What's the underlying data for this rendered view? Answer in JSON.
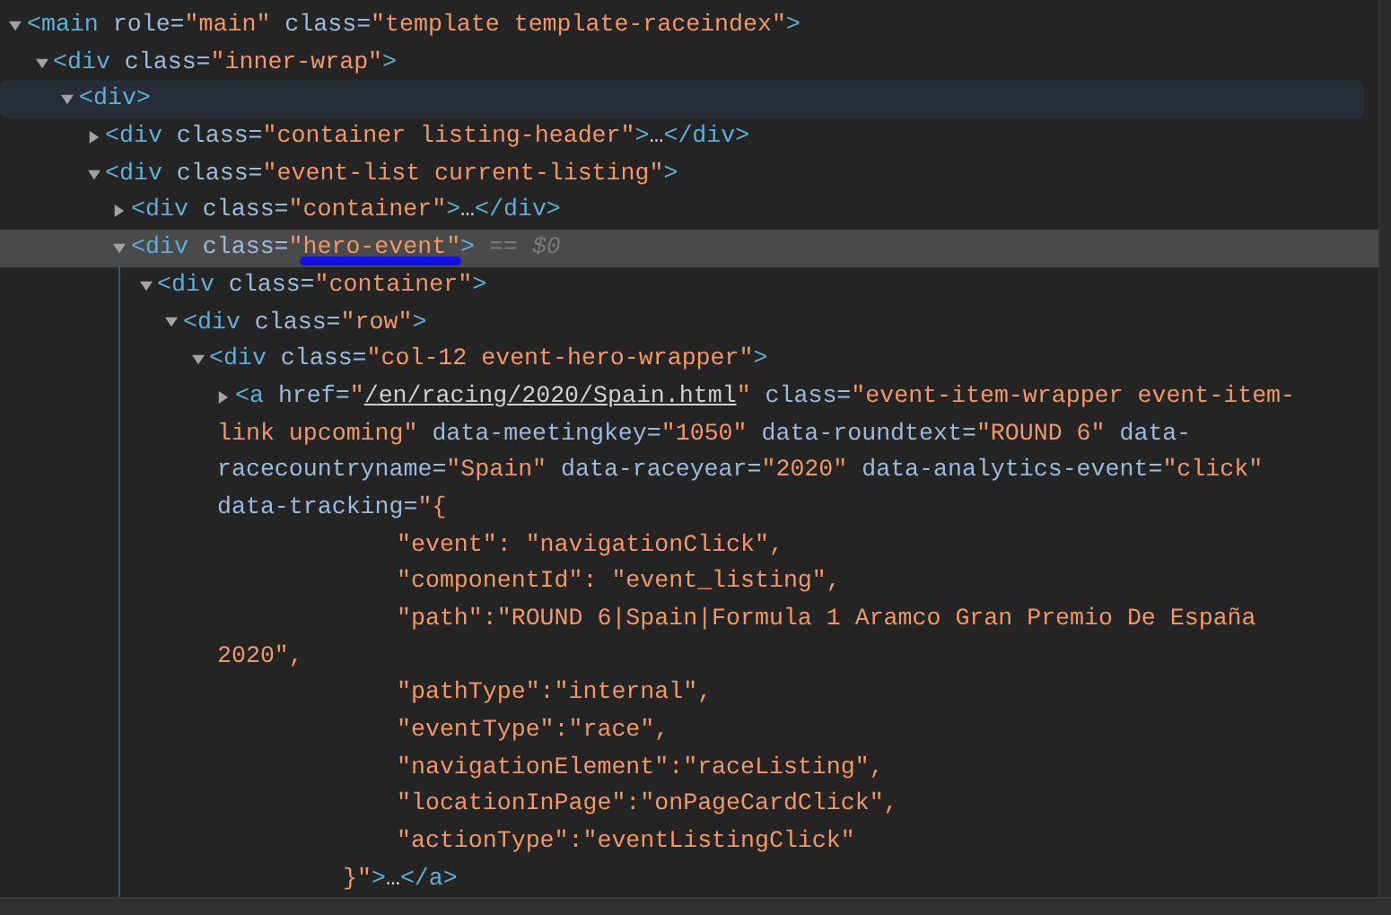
{
  "tree": [
    {
      "expanded": true,
      "selected": false,
      "hovered": false,
      "lines": [
        {
          "kind": "start",
          "tokens": [
            {
              "t": "<main",
              "kind": "tag"
            },
            {
              "t": " role=",
              "kind": "attr"
            },
            {
              "t": "\"main\"",
              "kind": "value"
            },
            {
              "t": " class=",
              "kind": "attr"
            },
            {
              "t": "\"template template-raceindex\"",
              "kind": "value"
            },
            {
              "t": ">",
              "kind": "tag"
            }
          ]
        }
      ],
      "children": [
        {
          "expanded": true,
          "selected": false,
          "hovered": false,
          "lines": [
            {
              "kind": "start",
              "tokens": [
                {
                  "t": "<div",
                  "kind": "tag"
                },
                {
                  "t": " class=",
                  "kind": "attr"
                },
                {
                  "t": "\"inner-wrap\"",
                  "kind": "value"
                },
                {
                  "t": ">",
                  "kind": "tag"
                }
              ]
            }
          ],
          "children": [
            {
              "expanded": true,
              "selected": false,
              "hovered": true,
              "lines": [
                {
                  "kind": "start",
                  "tokens": [
                    {
                      "t": "<div>",
                      "kind": "tag"
                    }
                  ]
                }
              ],
              "children": [
                {
                  "expanded": false,
                  "selected": false,
                  "hovered": false,
                  "lines": [
                    {
                      "kind": "start",
                      "tokens": [
                        {
                          "t": "<div",
                          "kind": "tag"
                        },
                        {
                          "t": " class=",
                          "kind": "attr"
                        },
                        {
                          "t": "\"container listing-header\"",
                          "kind": "value"
                        },
                        {
                          "t": ">",
                          "kind": "tag"
                        },
                        {
                          "t": "…",
                          "kind": "ellipsis"
                        },
                        {
                          "t": "</div>",
                          "kind": "tag"
                        }
                      ]
                    }
                  ]
                },
                {
                  "expanded": true,
                  "selected": false,
                  "hovered": false,
                  "lines": [
                    {
                      "kind": "start",
                      "tokens": [
                        {
                          "t": "<div",
                          "kind": "tag"
                        },
                        {
                          "t": " class=",
                          "kind": "attr"
                        },
                        {
                          "t": "\"event-list current-listing\"",
                          "kind": "value"
                        },
                        {
                          "t": ">",
                          "kind": "tag"
                        }
                      ]
                    }
                  ],
                  "children": [
                    {
                      "expanded": false,
                      "selected": false,
                      "hovered": false,
                      "lines": [
                        {
                          "kind": "start",
                          "tokens": [
                            {
                              "t": "<div",
                              "kind": "tag"
                            },
                            {
                              "t": " class=",
                              "kind": "attr"
                            },
                            {
                              "t": "\"container\"",
                              "kind": "value"
                            },
                            {
                              "t": ">",
                              "kind": "tag"
                            },
                            {
                              "t": "…",
                              "kind": "ellipsis"
                            },
                            {
                              "t": "</div>",
                              "kind": "tag"
                            }
                          ]
                        }
                      ]
                    },
                    {
                      "expanded": true,
                      "selected": true,
                      "hovered": false,
                      "lines": [
                        {
                          "kind": "start",
                          "tokens": [
                            {
                              "t": "<div",
                              "kind": "tag"
                            },
                            {
                              "t": " class=",
                              "kind": "attr"
                            },
                            {
                              "t": "\"",
                              "kind": "value"
                            },
                            {
                              "t": "hero-event",
                              "kind": "value",
                              "annotated": true
                            },
                            {
                              "t": "\"",
                              "kind": "value"
                            },
                            {
                              "t": ">",
                              "kind": "tag"
                            },
                            {
                              "t": " == $0",
                              "kind": "console"
                            }
                          ]
                        }
                      ],
                      "children": [
                        {
                          "expanded": true,
                          "selected": false,
                          "hovered": false,
                          "lines": [
                            {
                              "kind": "start",
                              "tokens": [
                                {
                                  "t": "<div",
                                  "kind": "tag"
                                },
                                {
                                  "t": " class=",
                                  "kind": "attr"
                                },
                                {
                                  "t": "\"container\"",
                                  "kind": "value"
                                },
                                {
                                  "t": ">",
                                  "kind": "tag"
                                }
                              ]
                            }
                          ],
                          "children": [
                            {
                              "expanded": true,
                              "selected": false,
                              "hovered": false,
                              "lines": [
                                {
                                  "kind": "start",
                                  "tokens": [
                                    {
                                      "t": "<div",
                                      "kind": "tag"
                                    },
                                    {
                                      "t": " class=",
                                      "kind": "attr"
                                    },
                                    {
                                      "t": "\"row\"",
                                      "kind": "value"
                                    },
                                    {
                                      "t": ">",
                                      "kind": "tag"
                                    }
                                  ]
                                }
                              ],
                              "children": [
                                {
                                  "expanded": true,
                                  "selected": false,
                                  "hovered": false,
                                  "lines": [
                                    {
                                      "kind": "start",
                                      "tokens": [
                                        {
                                          "t": "<div",
                                          "kind": "tag"
                                        },
                                        {
                                          "t": " class=",
                                          "kind": "attr"
                                        },
                                        {
                                          "t": "\"col-12 event-hero-wrapper\"",
                                          "kind": "value"
                                        },
                                        {
                                          "t": ">",
                                          "kind": "tag"
                                        }
                                      ]
                                    }
                                  ],
                                  "children": [
                                    {
                                      "expanded": false,
                                      "selected": false,
                                      "hovered": false,
                                      "lines": [
                                        {
                                          "kind": "start",
                                          "tokens": [
                                            {
                                              "t": "<a",
                                              "kind": "tag"
                                            },
                                            {
                                              "t": " href=",
                                              "kind": "attr"
                                            },
                                            {
                                              "t": "\"",
                                              "kind": "value"
                                            },
                                            {
                                              "t": "/en/racing/2020/Spain.html",
                                              "kind": "link"
                                            },
                                            {
                                              "t": "\"",
                                              "kind": "value"
                                            },
                                            {
                                              "t": " class=",
                                              "kind": "attr"
                                            },
                                            {
                                              "t": "\"event-item-wrapper event-item-",
                                              "kind": "value"
                                            }
                                          ]
                                        },
                                        {
                                          "kind": "wrap",
                                          "tokens": [
                                            {
                                              "t": "link upcoming\"",
                                              "kind": "value"
                                            },
                                            {
                                              "t": " data-meetingkey=",
                                              "kind": "attr"
                                            },
                                            {
                                              "t": "\"1050\"",
                                              "kind": "value"
                                            },
                                            {
                                              "t": " data-roundtext=",
                                              "kind": "attr"
                                            },
                                            {
                                              "t": "\"ROUND 6\"",
                                              "kind": "value"
                                            },
                                            {
                                              "t": " data-",
                                              "kind": "attr"
                                            }
                                          ]
                                        },
                                        {
                                          "kind": "wrap",
                                          "tokens": [
                                            {
                                              "t": "racecountryname=",
                                              "kind": "attr"
                                            },
                                            {
                                              "t": "\"Spain\"",
                                              "kind": "value"
                                            },
                                            {
                                              "t": " data-raceyear=",
                                              "kind": "attr"
                                            },
                                            {
                                              "t": "\"2020\"",
                                              "kind": "value"
                                            },
                                            {
                                              "t": " data-analytics-event=",
                                              "kind": "attr"
                                            },
                                            {
                                              "t": "\"click\"",
                                              "kind": "value"
                                            }
                                          ]
                                        },
                                        {
                                          "kind": "wrap",
                                          "tokens": [
                                            {
                                              "t": "data-tracking=",
                                              "kind": "attr"
                                            },
                                            {
                                              "t": "\"{",
                                              "kind": "value"
                                            }
                                          ]
                                        },
                                        {
                                          "kind": "entry",
                                          "tokens": [
                                            {
                                              "t": "\"event\": \"navigationClick\",",
                                              "kind": "value"
                                            }
                                          ]
                                        },
                                        {
                                          "kind": "entry",
                                          "tokens": [
                                            {
                                              "t": "\"componentId\": \"event_listing\",",
                                              "kind": "value"
                                            }
                                          ]
                                        },
                                        {
                                          "kind": "entry",
                                          "tokens": [
                                            {
                                              "t": "\"path\":\"ROUND 6|Spain|Formula 1 Aramco Gran Premio De España",
                                              "kind": "value"
                                            }
                                          ]
                                        },
                                        {
                                          "kind": "wrap",
                                          "tokens": [
                                            {
                                              "t": "2020\",",
                                              "kind": "value"
                                            }
                                          ]
                                        },
                                        {
                                          "kind": "entry",
                                          "tokens": [
                                            {
                                              "t": "\"pathType\":\"internal\",",
                                              "kind": "value"
                                            }
                                          ]
                                        },
                                        {
                                          "kind": "entry",
                                          "tokens": [
                                            {
                                              "t": "\"eventType\":\"race\",",
                                              "kind": "value"
                                            }
                                          ]
                                        },
                                        {
                                          "kind": "entry",
                                          "tokens": [
                                            {
                                              "t": "\"navigationElement\":\"raceListing\",",
                                              "kind": "value"
                                            }
                                          ]
                                        },
                                        {
                                          "kind": "entry",
                                          "tokens": [
                                            {
                                              "t": "\"locationInPage\":\"onPageCardClick\",",
                                              "kind": "value"
                                            }
                                          ]
                                        },
                                        {
                                          "kind": "entry",
                                          "tokens": [
                                            {
                                              "t": "\"actionType\":\"eventListingClick\"",
                                              "kind": "value"
                                            }
                                          ]
                                        },
                                        {
                                          "kind": "close",
                                          "tokens": [
                                            {
                                              "t": "}\"",
                                              "kind": "value"
                                            },
                                            {
                                              "t": ">",
                                              "kind": "tag"
                                            },
                                            {
                                              "t": "…",
                                              "kind": "ellipsis"
                                            },
                                            {
                                              "t": "</a>",
                                              "kind": "tag"
                                            }
                                          ]
                                        }
                                      ]
                                    }
                                  ]
                                }
                              ]
                            }
                          ]
                        }
                      ]
                    }
                  ]
                }
              ]
            }
          ]
        }
      ]
    }
  ]
}
